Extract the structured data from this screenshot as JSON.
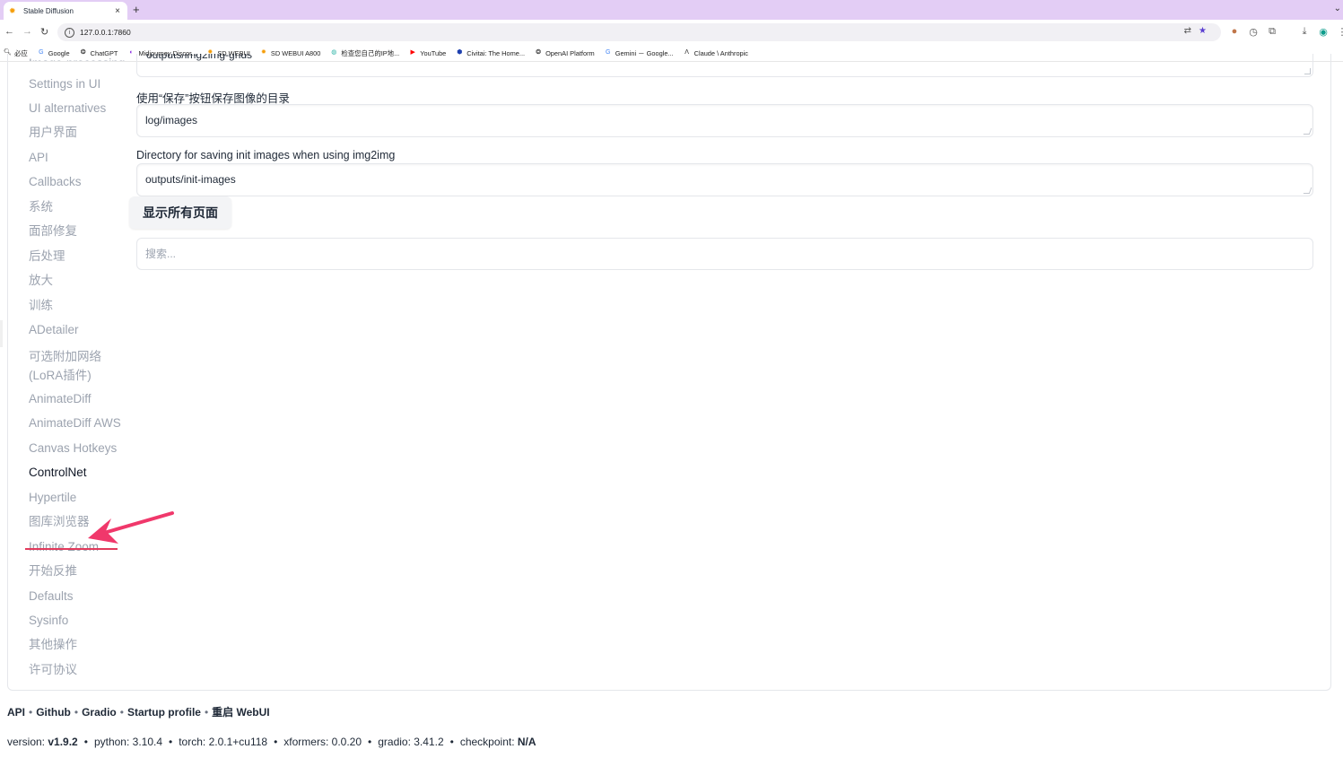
{
  "browser": {
    "tab_title": "Stable Diffusion",
    "url": "127.0.0.1:7860",
    "bookmarks": [
      {
        "label": "必应",
        "icon": "search-icon"
      },
      {
        "label": "Google",
        "icon": "google-icon"
      },
      {
        "label": "ChatGPT",
        "icon": "openai-icon"
      },
      {
        "label": "Midjourney Discor...",
        "icon": "discord-icon"
      },
      {
        "label": "SD WEBUI",
        "icon": "sd-icon"
      },
      {
        "label": "SD WEBUI A800",
        "icon": "sd-icon"
      },
      {
        "label": "检查您自己的IP地...",
        "icon": "globe-icon"
      },
      {
        "label": "YouTube",
        "icon": "youtube-icon"
      },
      {
        "label": "Civitai: The Home...",
        "icon": "civitai-icon"
      },
      {
        "label": "OpenAI Platform",
        "icon": "openai-icon"
      },
      {
        "label": "Gemini － Google...",
        "icon": "google-icon"
      },
      {
        "label": "Claude \\ Anthropic",
        "icon": "anthropic-icon"
      }
    ]
  },
  "sidebar": {
    "items": [
      {
        "label": "Settings in UI"
      },
      {
        "label": "UI alternatives"
      },
      {
        "label": "用户界面"
      },
      {
        "label": "API"
      },
      {
        "label": "Callbacks"
      },
      {
        "label": "系统"
      },
      {
        "label": "面部修复"
      },
      {
        "label": "后处理"
      },
      {
        "label": "放大"
      },
      {
        "label": "训练"
      },
      {
        "label": "ADetailer"
      },
      {
        "label": "可选附加网络(LoRA插件)"
      },
      {
        "label": "AnimateDiff"
      },
      {
        "label": "AnimateDiff AWS"
      },
      {
        "label": "Canvas Hotkeys"
      },
      {
        "label": "ControlNet"
      },
      {
        "label": "Hypertile"
      },
      {
        "label": "图库浏览器"
      },
      {
        "label": "Infinite Zoom"
      },
      {
        "label": "开始反推"
      },
      {
        "label": "Defaults"
      },
      {
        "label": "Sysinfo"
      },
      {
        "label": "其他操作"
      },
      {
        "label": "许可协议"
      }
    ],
    "active": "ControlNet"
  },
  "main": {
    "top_field_value": "outputs/img2img-grids",
    "fields": [
      {
        "label": "使用“保存”按钮保存图像的目录",
        "value": "log/images"
      },
      {
        "label": "Directory for saving init images when using img2img",
        "value": "outputs/init-images"
      }
    ],
    "show_all_button": "显示所有页面",
    "search_placeholder": "搜索..."
  },
  "footer": {
    "links": [
      "API",
      "Github",
      "Gradio",
      "Startup profile",
      "重启 WebUI"
    ],
    "versions": [
      {
        "key": "version: ",
        "value": "v1.9.2",
        "bold": true
      },
      {
        "key": "python: ",
        "value": "3.10.4",
        "bold": false
      },
      {
        "key": "torch: ",
        "value": "2.0.1+cu118",
        "bold": false
      },
      {
        "key": "xformers: ",
        "value": "0.0.20",
        "bold": false
      },
      {
        "key": "gradio: ",
        "value": "3.41.2",
        "bold": false
      },
      {
        "key": "checkpoint: ",
        "value": "N/A",
        "bold": true
      }
    ]
  },
  "colors": {
    "tabstrip": "#e3cdf5",
    "annotation_arrow": "#f0386b",
    "annotation_underline": "#e23a5c"
  }
}
